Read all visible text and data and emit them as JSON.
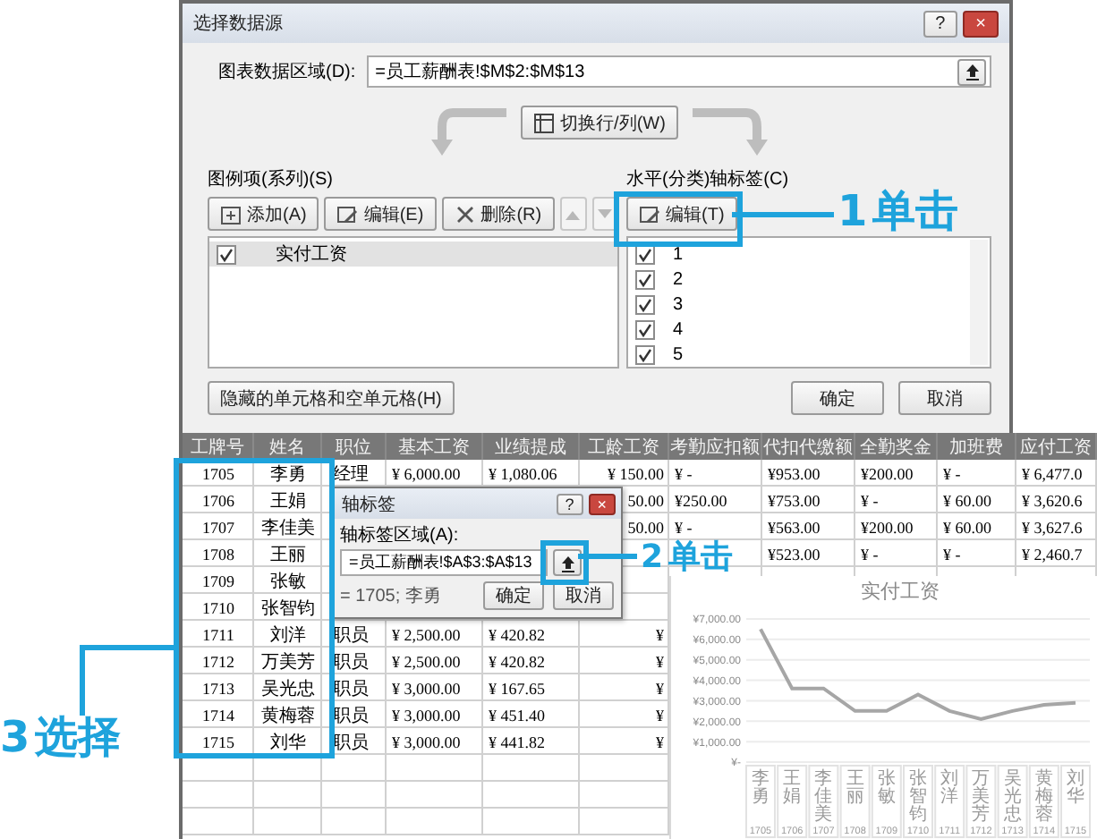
{
  "data_source_dialog": {
    "title": "选择数据源",
    "help_button": "?",
    "close_button": "×",
    "range_label": "图表数据区域(D):",
    "range_value": "=员工薪酬表!$M$2:$M$13",
    "switch_button": "切换行/列(W)",
    "series_label": "图例项(系列)(S)",
    "series_toolbar": [
      {
        "kind": "add",
        "label": "添加(A)",
        "disabled": false
      },
      {
        "kind": "edit",
        "label": "编辑(E)",
        "disabled": false
      },
      {
        "kind": "delete",
        "label": "删除(R)",
        "disabled": false
      },
      {
        "kind": "up",
        "disabled": true
      },
      {
        "kind": "down",
        "disabled": true
      }
    ],
    "series": [
      {
        "label": "实付工资",
        "checked": true,
        "selected": true
      }
    ],
    "axis_label": "水平(分类)轴标签(C)",
    "axis_edit_button": "编辑(T)",
    "categories": [
      {
        "label": "1",
        "checked": true
      },
      {
        "label": "2",
        "checked": true
      },
      {
        "label": "3",
        "checked": true
      },
      {
        "label": "4",
        "checked": true
      },
      {
        "label": "5",
        "checked": true
      }
    ],
    "hidden_cells_button": "隐藏的单元格和空单元格(H)",
    "buttons": [
      "确定",
      "取消"
    ]
  },
  "sheet": {
    "columns": [
      "工牌号",
      "姓名",
      "职位",
      "基本工资",
      "业绩提成",
      "工龄工资",
      "考勤应扣额",
      "代扣代缴额",
      "全勤奖金",
      "加班费",
      "应付工资"
    ],
    "rows": [
      [
        "1705",
        "李勇",
        "经理",
        "¥ 6,000.00",
        "¥ 1,080.06",
        "¥ 150.00",
        "¥ -",
        "¥953.00",
        "¥200.00",
        "¥ -",
        "¥ 6,477.0"
      ],
      [
        "1706",
        "王娟",
        null,
        null,
        null,
        "50.00",
        "¥250.00",
        "¥753.00",
        "¥ -",
        "¥ 60.00",
        "¥ 3,620.6"
      ],
      [
        "1707",
        "李佳美",
        null,
        null,
        null,
        "50.00",
        "¥ -",
        "¥563.00",
        "¥200.00",
        "¥ 60.00",
        "¥ 3,627.6"
      ],
      [
        "1708",
        "王丽",
        null,
        null,
        null,
        null,
        null,
        "¥523.00",
        "¥ -",
        "¥ -",
        "¥ 2,460.7"
      ],
      [
        "1709",
        "张敏",
        null,
        null,
        null,
        null,
        null,
        null,
        null,
        null,
        null
      ],
      [
        "1710",
        "张智钧",
        null,
        null,
        null,
        null,
        null,
        null,
        null,
        null,
        null
      ],
      [
        "1711",
        "刘洋",
        "职员",
        "¥ 2,500.00",
        "¥ 420.82",
        "¥",
        null,
        null,
        null,
        null,
        null
      ],
      [
        "1712",
        "万美芳",
        "职员",
        "¥ 2,500.00",
        "¥ 420.82",
        "¥",
        null,
        null,
        null,
        null,
        null
      ],
      [
        "1713",
        "吴光忠",
        "职员",
        "¥ 3,000.00",
        "¥ 167.65",
        "¥",
        null,
        null,
        null,
        null,
        null
      ],
      [
        "1714",
        "黄梅蓉",
        "职员",
        "¥ 3,000.00",
        "¥ 451.40",
        "¥",
        null,
        null,
        null,
        null,
        null
      ],
      [
        "1715",
        "刘华",
        "职员",
        "¥ 3,000.00",
        "¥ 441.82",
        "¥",
        null,
        null,
        null,
        null,
        null
      ]
    ]
  },
  "axis_dialog": {
    "title": "轴标签",
    "help_button": "?",
    "close_button": "×",
    "range_label": "轴标签区域(A):",
    "range_value": "=员工薪酬表!$A$3:$A$13",
    "preview": "= 1705; 李勇",
    "buttons": [
      "确定",
      "取消"
    ]
  },
  "chart": {
    "category_codes": [
      "1705",
      "1706",
      "1707",
      "1708",
      "1709",
      "1710",
      "1711",
      "1712",
      "1713",
      "1714",
      "1715"
    ],
    "chart_data": {
      "type": "line",
      "title": "实付工资",
      "categories": [
        "李勇",
        "王娟",
        "李佳美",
        "王丽",
        "张敏",
        "张智钧",
        "刘洋",
        "万美芳",
        "吴光忠",
        "黄梅蓉",
        "刘华"
      ],
      "series": [
        {
          "color": "#a6a6a6",
          "values": [
            6500,
            3600,
            3600,
            2500,
            2500,
            3300,
            2500,
            2100,
            2500,
            2800,
            2900
          ]
        }
      ],
      "ylim": [
        0,
        7000
      ],
      "grid": true,
      "yticks": [
        {
          "value": 7000,
          "label": "¥7,000.00"
        },
        {
          "value": 6000,
          "label": "¥6,000.00"
        },
        {
          "value": 5000,
          "label": "¥5,000.00"
        },
        {
          "value": 4000,
          "label": "¥4,000.00"
        },
        {
          "value": 3000,
          "label": "¥3,000.00"
        },
        {
          "value": 2000,
          "label": "¥2,000.00"
        },
        {
          "value": 1000,
          "label": "¥1,000.00"
        },
        {
          "value": 0,
          "label": "¥-"
        }
      ]
    }
  },
  "callouts": [
    {
      "number": "1",
      "text": "单击"
    },
    {
      "number": "2",
      "text": "单击"
    },
    {
      "number": "3",
      "text": "选择"
    }
  ]
}
